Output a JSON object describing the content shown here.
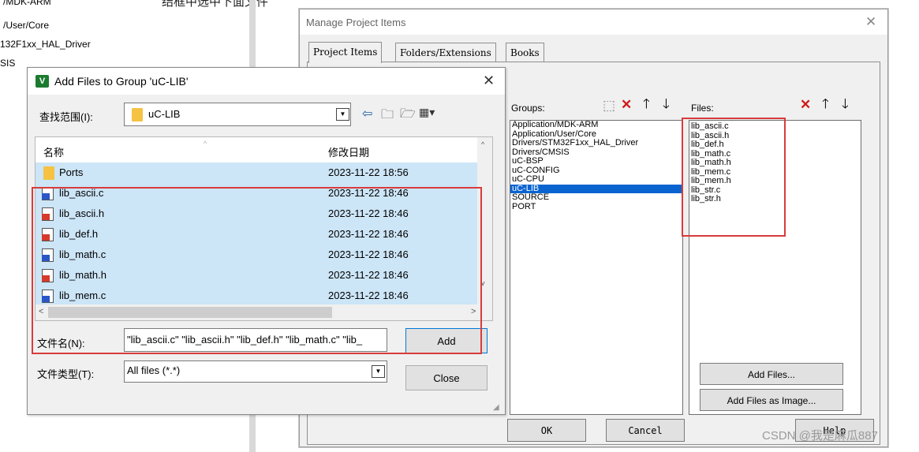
{
  "background": {
    "top_caption": "结框中选中下面文件",
    "tree_lines": [
      "/MDK-ARM",
      "/User/Core",
      "132F1xx_HAL_Driver",
      "SIS"
    ]
  },
  "manage_dialog": {
    "title": "Manage Project Items",
    "tabs": [
      "Project Items",
      "Folders/Extensions",
      "Books"
    ],
    "groups_label": "Groups:",
    "files_label": "Files:",
    "groups": [
      "Application/MDK-ARM",
      "Application/User/Core",
      "Drivers/STM32F1xx_HAL_Driver",
      "Drivers/CMSIS",
      "uC-BSP",
      "uC-CONFIG",
      "uC-CPU",
      "uC-LIB",
      "SOURCE",
      "PORT"
    ],
    "selected_group_index": 7,
    "files": [
      "lib_ascii.c",
      "lib_ascii.h",
      "lib_def.h",
      "lib_math.c",
      "lib_math.h",
      "lib_mem.c",
      "lib_mem.h",
      "lib_str.c",
      "lib_str.h"
    ],
    "buttons": {
      "add_files": "Add Files...",
      "add_files_as_image": "Add Files as Image...",
      "ok": "OK",
      "cancel": "Cancel",
      "help": "Help"
    }
  },
  "add_files_dialog": {
    "title": "Add Files to Group 'uC-LIB'",
    "look_in_label": "查找范围(I):",
    "look_in_value": "uC-LIB",
    "columns": {
      "name": "名称",
      "date": "修改日期"
    },
    "rows": [
      {
        "name": "Ports",
        "date": "2023-11-22 18:56",
        "kind": "folder"
      },
      {
        "name": "lib_ascii.c",
        "date": "2023-11-22 18:46",
        "kind": "c"
      },
      {
        "name": "lib_ascii.h",
        "date": "2023-11-22 18:46",
        "kind": "h"
      },
      {
        "name": "lib_def.h",
        "date": "2023-11-22 18:46",
        "kind": "h"
      },
      {
        "name": "lib_math.c",
        "date": "2023-11-22 18:46",
        "kind": "c"
      },
      {
        "name": "lib_math.h",
        "date": "2023-11-22 18:46",
        "kind": "h"
      },
      {
        "name": "lib_mem.c",
        "date": "2023-11-22 18:46",
        "kind": "c"
      }
    ],
    "filename_label": "文件名(N):",
    "filename_value": "\"lib_ascii.c\" \"lib_ascii.h\" \"lib_def.h\" \"lib_math.c\" \"lib_",
    "filetype_label": "文件类型(T):",
    "filetype_value": "All files (*.*)",
    "add_button": "Add",
    "close_button": "Close"
  },
  "watermark": "CSDN @我是麻瓜887",
  "colors": {
    "highlight_red": "#d83b3b",
    "selection_blue": "#0a64d0",
    "row_selected": "#cce5f7"
  }
}
